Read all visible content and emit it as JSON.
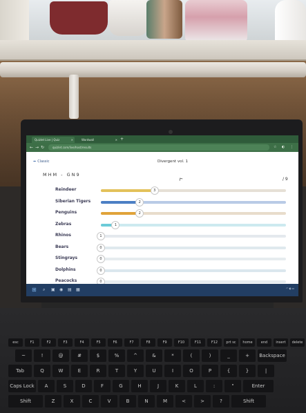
{
  "browser": {
    "tabs": [
      {
        "label": "Quizlet Live | Quiz"
      },
      {
        "label": "Wordwall"
      }
    ],
    "new_tab_symbol": "+",
    "url": "quizlet.com/live/host/results",
    "nav": {
      "back": "←",
      "forward": "→",
      "reload": "↻"
    }
  },
  "page": {
    "classic_label": "Classic",
    "title": "Divergent vol. 1",
    "session_code": "MHM - GN9",
    "count": "/ 9",
    "accent_colors": {
      "yellow": "#e3c15a",
      "blue": "#4c7fc4",
      "orange": "#e0a33a",
      "teal": "#6ccbd8",
      "track": "#dde3ea"
    },
    "rows": [
      {
        "label": "Reindeer",
        "value": 3,
        "fill_fraction": 0.29,
        "fill_color": "#e3c15a",
        "track_color": "#e6e0d6"
      },
      {
        "label": "Siberian Tigers",
        "value": 2,
        "fill_fraction": 0.21,
        "fill_color": "#4c7fc4",
        "track_color": "#b9cbe6"
      },
      {
        "label": "Penguins",
        "value": 2,
        "fill_fraction": 0.21,
        "fill_color": "#e0a33a",
        "track_color": "#e8dccb"
      },
      {
        "label": "Zebras",
        "value": 1,
        "fill_fraction": 0.08,
        "fill_color": "#6ccbd8",
        "track_color": "#cdeaf0"
      },
      {
        "label": "Rhinos",
        "value": 1,
        "fill_fraction": 0.0,
        "fill_color": "#9ab0c6",
        "track_color": "#e4e9ee"
      },
      {
        "label": "Bears",
        "value": 0,
        "fill_fraction": 0.0,
        "fill_color": "#9ab0c6",
        "track_color": "#dfe9ee"
      },
      {
        "label": "Stingrays",
        "value": 0,
        "fill_fraction": 0.0,
        "fill_color": "#9ab0c6",
        "track_color": "#e6ecef"
      },
      {
        "label": "Dolphins",
        "value": 0,
        "fill_fraction": 0.0,
        "fill_color": "#9ab0c6",
        "track_color": "#dbe7ee"
      },
      {
        "label": "Peacocks",
        "value": 0,
        "fill_fraction": 0.0,
        "fill_color": "#9ab0c6",
        "track_color": "#e6ecef"
      }
    ]
  },
  "taskbar": {
    "start_symbol": "⊞",
    "icons": [
      "search-icon",
      "task-view-icon",
      "edge-icon",
      "explorer-icon",
      "store-icon"
    ],
    "icon_glyphs": [
      "⌕",
      "▣",
      "◉",
      "▤",
      "▦"
    ]
  },
  "keyboard": {
    "fn_row": [
      "esc",
      "F1",
      "F2",
      "F3",
      "F4",
      "F5",
      "F6",
      "F7",
      "F8",
      "F9",
      "F10",
      "F11",
      "F12",
      "prt sc",
      "home",
      "end",
      "insert",
      "delete"
    ],
    "number_row": [
      "~",
      "!",
      "@",
      "#",
      "$",
      "%",
      "^",
      "&",
      "*",
      "(",
      ")",
      "_",
      "+",
      "Backspace"
    ],
    "q_row": [
      "Tab",
      "Q",
      "W",
      "E",
      "R",
      "T",
      "Y",
      "U",
      "I",
      "O",
      "P",
      "{",
      "}",
      "|"
    ],
    "a_row": [
      "Caps Lock",
      "A",
      "S",
      "D",
      "F",
      "G",
      "H",
      "J",
      "K",
      "L",
      ":",
      "\"",
      "Enter"
    ],
    "z_row": [
      "Shift",
      "Z",
      "X",
      "C",
      "V",
      "B",
      "N",
      "M",
      "<",
      ">",
      "?",
      "Shift"
    ]
  }
}
